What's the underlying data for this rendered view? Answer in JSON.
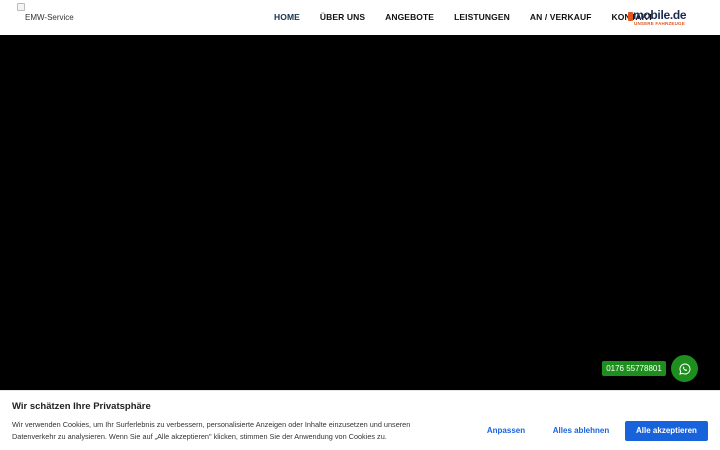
{
  "header": {
    "logo_alt": "EMW-Service",
    "nav": [
      {
        "label": "HOME"
      },
      {
        "label": "ÜBER UNS"
      },
      {
        "label": "ANGEBOTE"
      },
      {
        "label": "LEISTUNGEN"
      },
      {
        "label": "AN / VERKAUF"
      },
      {
        "label": "KONTAKT"
      }
    ],
    "partner_logo": {
      "word": "mobile.de",
      "tagline": "UNSERE FAHRZEUGE"
    }
  },
  "contact": {
    "phone": "0176 55778801",
    "whatsapp_icon": "whatsapp-icon"
  },
  "cookie_banner": {
    "title": "Wir schätzen Ihre Privatsphäre",
    "text": "Wir verwenden Cookies, um Ihr Surferlebnis zu verbessern, personalisierte Anzeigen oder Inhalte einzusetzen und unseren Datenverkehr zu analysieren. Wenn Sie auf „Alle akzeptieren\" klicken, stimmen Sie der Anwendung von Cookies zu.",
    "buttons": {
      "adjust": "Anpassen",
      "reject": "Alles ablehnen",
      "accept": "Alle akzeptieren"
    }
  },
  "colors": {
    "accent": "#1863dc",
    "nav_active": "#15324f",
    "whatsapp_green": "#1e8f1e",
    "hero_bg": "#000000"
  }
}
